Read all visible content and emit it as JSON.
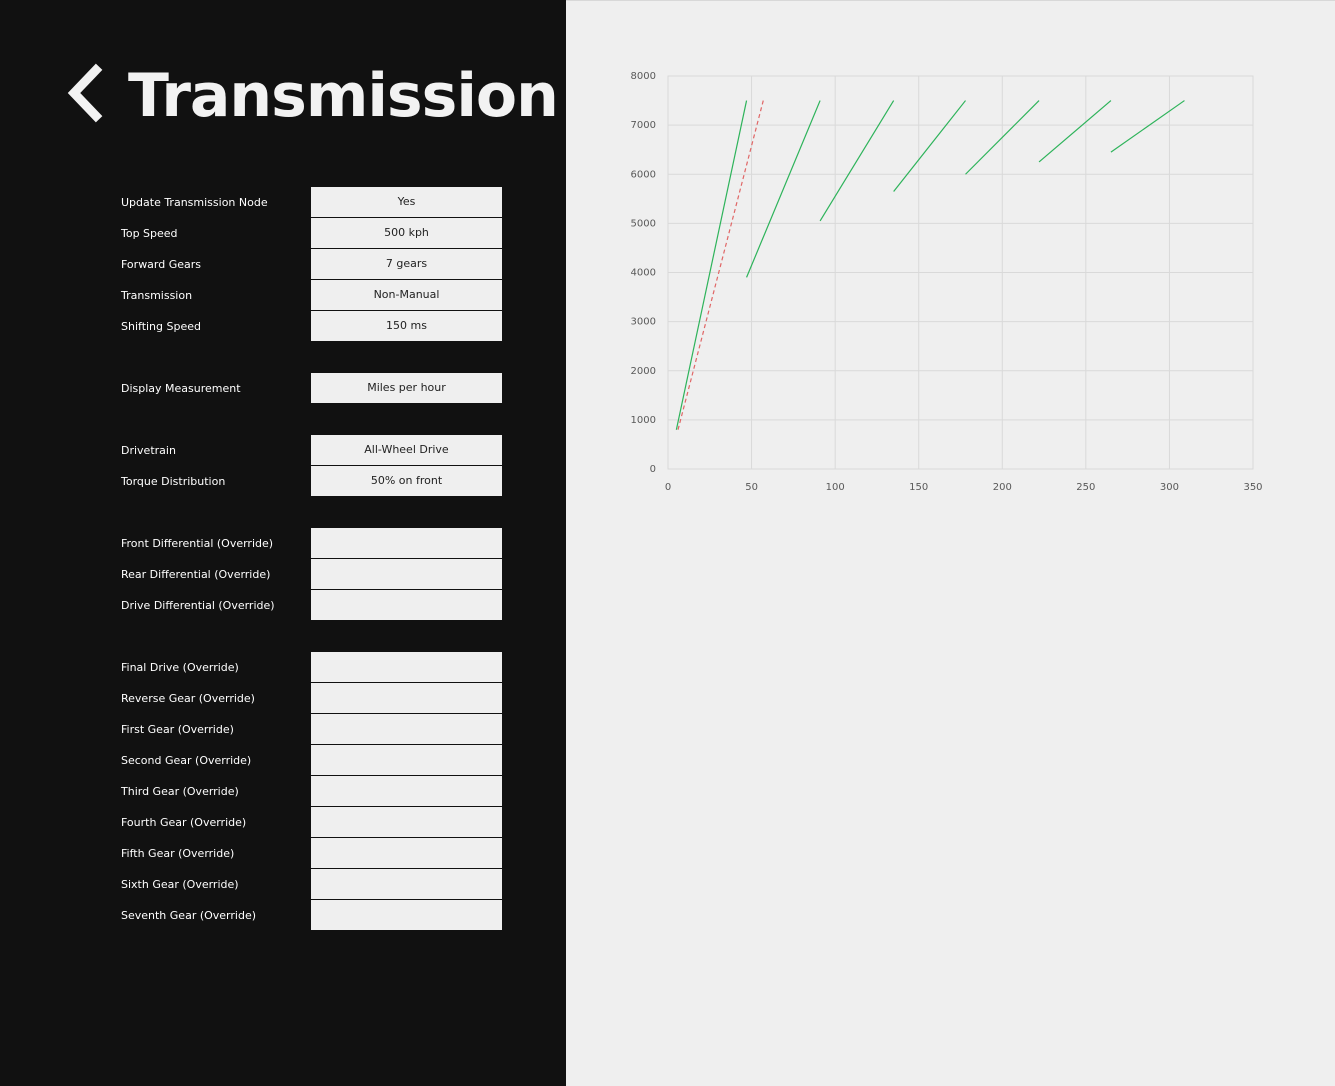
{
  "header": {
    "back_icon": "chevron-left-icon",
    "title": "Transmission"
  },
  "settings": {
    "groups": [
      {
        "rows": [
          {
            "label": "Update Transmission Node",
            "value": "Yes"
          },
          {
            "label": "Top Speed",
            "value": "500 kph"
          },
          {
            "label": "Forward Gears",
            "value": "7 gears"
          },
          {
            "label": "Transmission",
            "value": "Non-Manual"
          },
          {
            "label": "Shifting Speed",
            "value": "150 ms"
          }
        ]
      },
      {
        "rows": [
          {
            "label": "Display Measurement",
            "value": "Miles per hour"
          }
        ]
      },
      {
        "rows": [
          {
            "label": "Drivetrain",
            "value": "All-Wheel Drive"
          },
          {
            "label": "Torque Distribution",
            "value": "50% on front"
          }
        ]
      },
      {
        "rows": [
          {
            "label": "Front Differential (Override)",
            "value": ""
          },
          {
            "label": "Rear Differential (Override)",
            "value": ""
          },
          {
            "label": "Drive Differential (Override)",
            "value": ""
          }
        ]
      },
      {
        "rows": [
          {
            "label": "Final Drive (Override)",
            "value": ""
          },
          {
            "label": "Reverse Gear (Override)",
            "value": ""
          },
          {
            "label": "First Gear (Override)",
            "value": ""
          },
          {
            "label": "Second Gear (Override)",
            "value": ""
          },
          {
            "label": "Third Gear (Override)",
            "value": ""
          },
          {
            "label": "Fourth Gear (Override)",
            "value": ""
          },
          {
            "label": "Fifth Gear (Override)",
            "value": ""
          },
          {
            "label": "Sixth Gear (Override)",
            "value": ""
          },
          {
            "label": "Seventh Gear (Override)",
            "value": ""
          }
        ]
      }
    ]
  },
  "colors": {
    "panel_background": "#111111",
    "content_background": "#efefef",
    "field_background": "#efefef",
    "gear_line": "#2db35a",
    "reverse_line": "#e06666",
    "grid": "#d9d9d9"
  },
  "chart_data": {
    "type": "line",
    "xlim": [
      0,
      350
    ],
    "ylim": [
      0,
      8000
    ],
    "xticks": [
      0,
      50,
      100,
      150,
      200,
      250,
      300,
      350
    ],
    "yticks": [
      0,
      1000,
      2000,
      3000,
      4000,
      5000,
      6000,
      7000,
      8000
    ],
    "grid": true,
    "legend": "none",
    "series": [
      {
        "style": "solid",
        "color": "#2db35a",
        "points": [
          [
            5,
            800
          ],
          [
            47,
            7500
          ]
        ]
      },
      {
        "style": "solid",
        "color": "#2db35a",
        "points": [
          [
            47,
            3900
          ],
          [
            91,
            7500
          ]
        ]
      },
      {
        "style": "solid",
        "color": "#2db35a",
        "points": [
          [
            91,
            5050
          ],
          [
            135,
            7500
          ]
        ]
      },
      {
        "style": "solid",
        "color": "#2db35a",
        "points": [
          [
            135,
            5650
          ],
          [
            178,
            7500
          ]
        ]
      },
      {
        "style": "solid",
        "color": "#2db35a",
        "points": [
          [
            178,
            6000
          ],
          [
            222,
            7500
          ]
        ]
      },
      {
        "style": "solid",
        "color": "#2db35a",
        "points": [
          [
            222,
            6250
          ],
          [
            265,
            7500
          ]
        ]
      },
      {
        "style": "solid",
        "color": "#2db35a",
        "points": [
          [
            265,
            6450
          ],
          [
            309,
            7500
          ]
        ]
      },
      {
        "style": "dashed",
        "color": "#e06666",
        "points": [
          [
            6,
            800
          ],
          [
            57,
            7500
          ]
        ]
      }
    ]
  }
}
